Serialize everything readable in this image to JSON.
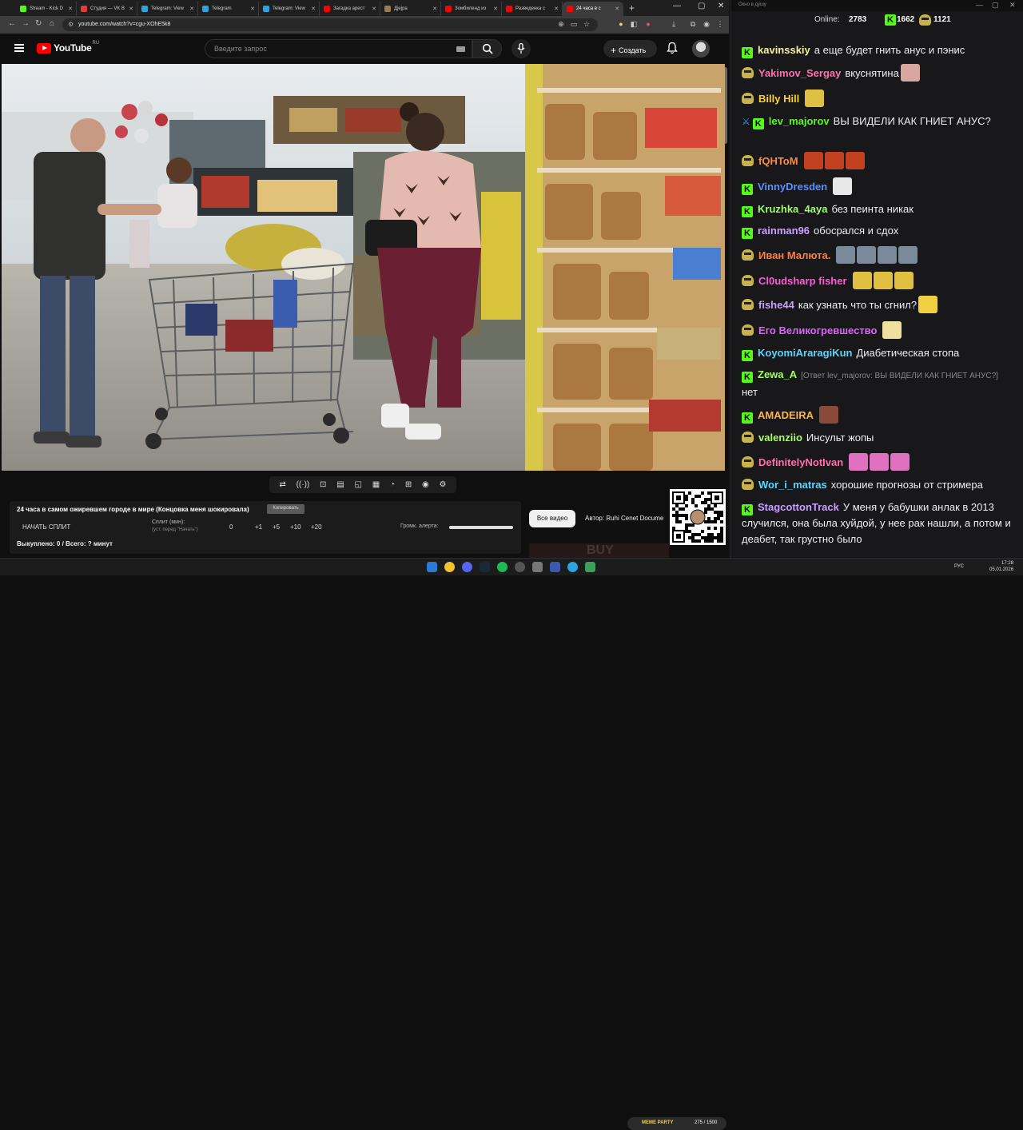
{
  "browser": {
    "tabs": [
      {
        "title": "Stream - Kick D",
        "color": "#53fc18",
        "active": false
      },
      {
        "title": "Студия — VK B",
        "color": "#e53935",
        "active": false
      },
      {
        "title": "Telegram: View",
        "color": "#2aa3e0",
        "active": false
      },
      {
        "title": "Telegram",
        "color": "#2aa3e0",
        "active": false
      },
      {
        "title": "Telegram: View",
        "color": "#2aa3e0",
        "active": false
      },
      {
        "title": "Загадка арест",
        "color": "#ff0000",
        "active": false
      },
      {
        "title": "Дјејра",
        "color": "#9c7b4a",
        "active": false
      },
      {
        "title": "Зомбиленд из",
        "color": "#ff0000",
        "active": false
      },
      {
        "title": "Разведенка с",
        "color": "#ff0000",
        "active": false
      },
      {
        "title": "24 часа в с",
        "color": "#ff0000",
        "active": true
      }
    ],
    "new_tab": "+",
    "url": "youtube.com/watch?v=cgu-XOhE5k8"
  },
  "youtube": {
    "logo_text": "YouTube",
    "logo_region": "RU",
    "search_placeholder": "Введите запрос",
    "create_label": "Создать",
    "create_plus": "+"
  },
  "extension_toolbar": {
    "icons": [
      "repeat-icon",
      "broadcast-icon",
      "screen-record-icon",
      "film-icon",
      "picture-in-picture-icon",
      "dotted-frame-icon",
      "speedometer-icon",
      "add-media-icon",
      "camera-icon",
      "gear-icon"
    ],
    "glyphs": [
      "⇄",
      "((·))",
      "⊡",
      "▤",
      "◱",
      "▦",
      "◔",
      "⊞",
      "◉",
      "⚙"
    ]
  },
  "split_panel": {
    "title": "24 часа в самом ожиревшем городе в мире (Концовка меня шокировала)",
    "copy_label": "Копировать",
    "start_label": "НАЧАТЬ СПЛИТ",
    "split_label": "Сплит (мин):",
    "split_hint": "(уст. перед \"Начать\")",
    "value": "0",
    "steps": [
      "+1",
      "+5",
      "+10",
      "+20"
    ],
    "alert_label": "Громк. алерта:",
    "alert_level": 1.0,
    "bought": "Выкуплено: 0 / Всего: ? минут"
  },
  "sidebar": {
    "all_videos": "Все видео",
    "author": "Автор: Ruhi Cenet Docume"
  },
  "chat": {
    "window_title": "Окно в душу",
    "online_label": "Online:",
    "online_count": "2783",
    "kick_count": "1662",
    "pepe_count": "1121",
    "messages": [
      {
        "badge": "kick",
        "name": "kavinsskiy",
        "color": "#f2f2a0",
        "text": "а еще будет гнить анус и пэнис"
      },
      {
        "badge": "pepe",
        "name": "Yakimov_Sergay",
        "color": "#ff6fae",
        "text": "вкуснятина"
      },
      {
        "badge": "pepe",
        "name": "Billy Hill",
        "color": "#ffd21f",
        "text": ""
      },
      {
        "badge": "sword-kick",
        "name": "lev_majorov",
        "color": "#53fc18",
        "text": "ВЫ ВИДЕЛИ КАК ГНИЕТ АНУС?"
      },
      {
        "badge": "pepe",
        "name": "fQHToM",
        "color": "#ff8a3d",
        "text": ""
      },
      {
        "badge": "kick",
        "name": "VinnyDresden",
        "color": "#5a8fff",
        "text": ""
      },
      {
        "badge": "kick",
        "name": "Kruzhka_4aya",
        "color": "#9cff6a",
        "text": "без пеинта никак"
      },
      {
        "badge": "kick",
        "name": "rainman96",
        "color": "#c9a0ff",
        "text": "обосрался и сдох"
      },
      {
        "badge": "pepe",
        "name": "Иван Малюта.",
        "color": "#ff7f3f",
        "text": ""
      },
      {
        "badge": "pepe",
        "name": "Cl0udsharp fisher",
        "color": "#ff5ad7",
        "text": ""
      },
      {
        "badge": "pepe",
        "name": "fishe44",
        "color": "#c9a0ff",
        "text": "как узнать что ты сгнил?"
      },
      {
        "badge": "pepe",
        "name": "Его Великогревшество",
        "color": "#e060ff",
        "text": ""
      },
      {
        "badge": "kick",
        "name": "KoyomiAraragiKun",
        "color": "#5ad6ff",
        "text": "Диабетическая стопа"
      },
      {
        "badge": "kick",
        "name": "Zewa_A",
        "color": "#a4ff5a",
        "reply": "[Ответ lev_majorov: ВЫ ВИДЕЛИ КАК ГНИЕТ АНУС?]",
        "text": "нет"
      },
      {
        "badge": "kick",
        "name": "AMADEIRA",
        "color": "#ffb347",
        "text": ""
      },
      {
        "badge": "pepe",
        "name": "valenziio",
        "color": "#a4ff5a",
        "text": "Инсульт жопы"
      },
      {
        "badge": "pepe",
        "name": "DefinitelyNotIvan",
        "color": "#ff6fae",
        "text": ""
      },
      {
        "badge": "pepe",
        "name": "Wor_i_matras",
        "color": "#5ad6ff",
        "text": "хорошие прогнозы от стримера"
      },
      {
        "badge": "kick",
        "name": "StagcottonTrack",
        "color": "#c9a0ff",
        "text": "У меня у бабушки анлак в 2013 случился, она была хуйдой, у нее рак нашли, а потом и деабет, так грустно было"
      }
    ]
  },
  "taskbar": {
    "lang": "РУС",
    "time": "17:28",
    "date": "05.01.2026",
    "meme_party_label": "MEME PARTY",
    "meme_party_count": "275 / 1500"
  }
}
